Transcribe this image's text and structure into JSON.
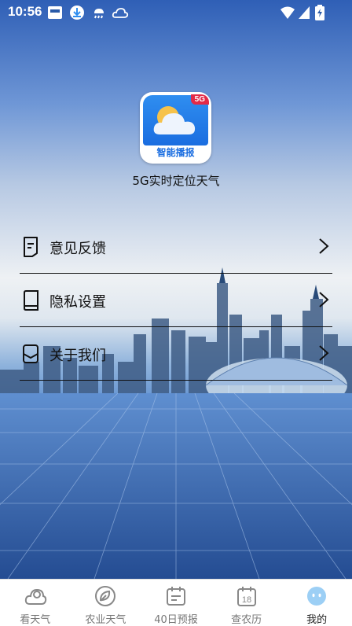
{
  "status_bar": {
    "time": "10:56"
  },
  "app": {
    "name": "5G实时定位天气",
    "icon_badge": "5G",
    "icon_caption": "智能播报"
  },
  "menu": [
    {
      "label": "意见反馈",
      "icon": "feedback-icon"
    },
    {
      "label": "隐私设置",
      "icon": "book-icon"
    },
    {
      "label": "关于我们",
      "icon": "about-icon"
    }
  ],
  "tabs": [
    {
      "label": "看天气",
      "icon": "cloud-icon",
      "active": false
    },
    {
      "label": "农业天气",
      "icon": "leaf-icon",
      "active": false
    },
    {
      "label": "40日预报",
      "icon": "calendar-icon",
      "active": false
    },
    {
      "label": "查农历",
      "icon": "date-18-icon",
      "active": false,
      "icon_text": "18"
    },
    {
      "label": "我的",
      "icon": "face-icon",
      "active": true
    }
  ],
  "colors": {
    "accent": "#1a6de0",
    "badge": "#e22a48"
  }
}
